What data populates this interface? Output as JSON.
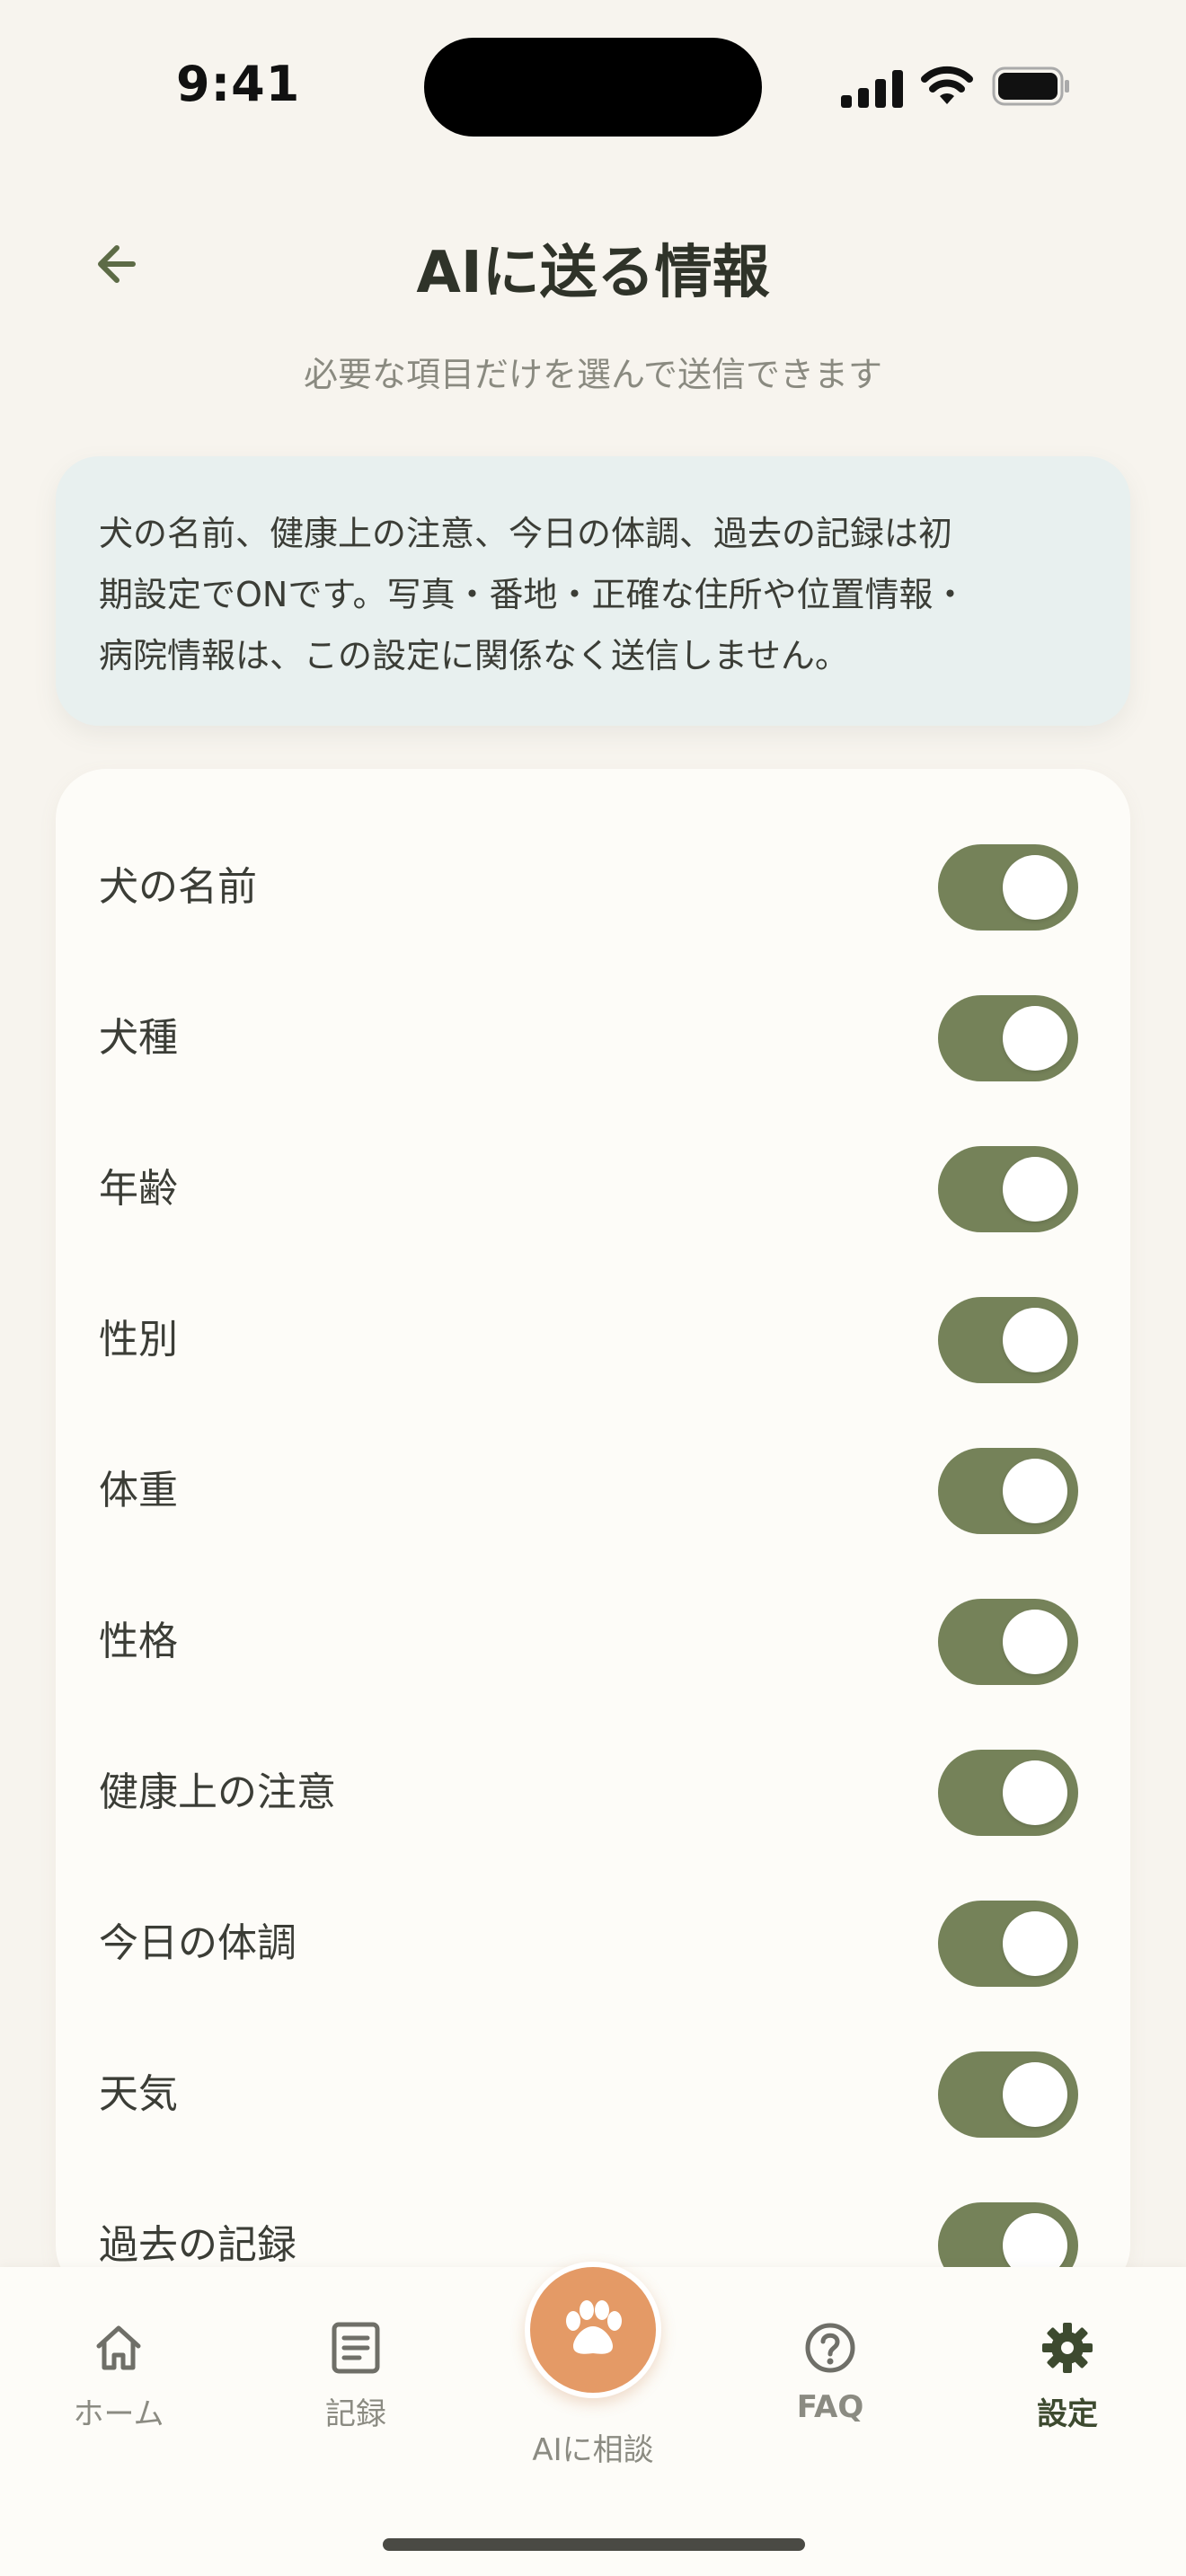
{
  "status_bar": {
    "time": "9:41"
  },
  "header": {
    "title": "AIに送る情報",
    "subtitle": "必要な項目だけを選んで送信できます"
  },
  "info": {
    "lines": [
      "犬の名前、健康上の注意、今日の体調、過去の記録は初",
      "期設定でONです。写真・番地・正確な住所や位置情報・",
      "病院情報は、この設定に関係なく送信しません。"
    ]
  },
  "settings": [
    {
      "label": "犬の名前",
      "on": true
    },
    {
      "label": "犬種",
      "on": true
    },
    {
      "label": "年齢",
      "on": true
    },
    {
      "label": "性別",
      "on": true
    },
    {
      "label": "体重",
      "on": true
    },
    {
      "label": "性格",
      "on": true
    },
    {
      "label": "健康上の注意",
      "on": true
    },
    {
      "label": "今日の体調",
      "on": true
    },
    {
      "label": "天気",
      "on": true
    },
    {
      "label": "過去の記録",
      "on": true
    }
  ],
  "tabbar": {
    "home": "ホーム",
    "records": "記録",
    "ai": "AIに相談",
    "faq": "FAQ",
    "settings": "設定"
  },
  "colors": {
    "toggle_on": "#758259",
    "accent_orange": "#e49a66",
    "info_bg": "#e8f0ef",
    "page_bg": "#f7f4ee"
  }
}
